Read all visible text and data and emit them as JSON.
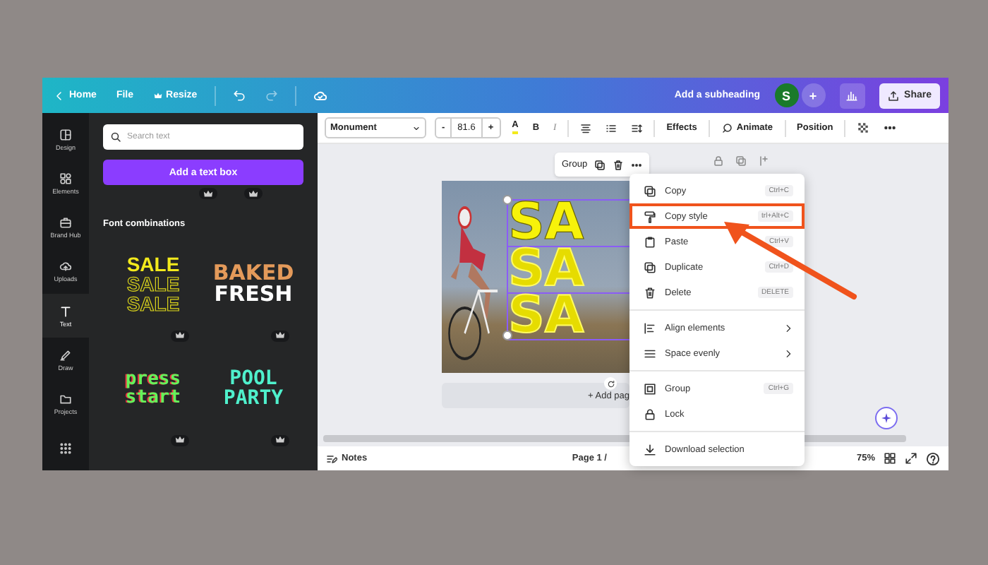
{
  "top_bar": {
    "home": "Home",
    "file": "File",
    "resize": "Resize",
    "title": "Add a subheading",
    "avatar": "S",
    "plus": "+",
    "share": "Share"
  },
  "rail": [
    {
      "label": "Design",
      "selected": false
    },
    {
      "label": "Elements",
      "selected": false
    },
    {
      "label": "Brand Hub",
      "selected": false
    },
    {
      "label": "Uploads",
      "selected": false
    },
    {
      "label": "Text",
      "selected": true
    },
    {
      "label": "Draw",
      "selected": false
    },
    {
      "label": "Projects",
      "selected": false
    },
    {
      "selected": false
    }
  ],
  "panel": {
    "search": {
      "placeholder": "Search text"
    },
    "add_button": "Add a text box",
    "section_title": "Font combinations",
    "combos": [
      {
        "kind": "sale",
        "lines": [
          "SALE",
          "SALE",
          "SALE"
        ]
      },
      {
        "kind": "baked",
        "lines": [
          "BAKED",
          "FRESH"
        ]
      },
      {
        "kind": "press",
        "lines": [
          "press",
          "start"
        ]
      },
      {
        "kind": "pool",
        "lines": [
          "POOL",
          "PARTY"
        ]
      }
    ]
  },
  "toolbar": {
    "font": "Monument",
    "decrease": "-",
    "font_size": "81.6",
    "increase": "+",
    "color_letter": "A",
    "bold": "B",
    "italic": "I",
    "effects": "Effects",
    "animate": "Animate",
    "position": "Position"
  },
  "canvas": {
    "selection_label": "Group",
    "text_layers": [
      "SA",
      "SA",
      "SA"
    ],
    "add_page": "+ Add pag"
  },
  "context_menu": [
    {
      "kind": "item",
      "label": "Copy",
      "shortcut": "Ctrl+C",
      "highlighted": false
    },
    {
      "kind": "item",
      "label": "Copy style",
      "shortcut": "trl+Alt+C",
      "highlighted": true
    },
    {
      "kind": "item",
      "label": "Paste",
      "shortcut": "Ctrl+V",
      "highlighted": false
    },
    {
      "kind": "item",
      "label": "Duplicate",
      "shortcut": "Ctrl+D",
      "highlighted": false
    },
    {
      "kind": "item",
      "label": "Delete",
      "shortcut": "DELETE",
      "highlighted": false
    },
    {
      "kind": "divider"
    },
    {
      "kind": "submenu",
      "label": "Align elements",
      "highlighted": false
    },
    {
      "kind": "submenu",
      "label": "Space evenly",
      "highlighted": false
    },
    {
      "kind": "divider"
    },
    {
      "kind": "item",
      "label": "Group",
      "shortcut": "Ctrl+G",
      "highlighted": false
    },
    {
      "kind": "item",
      "label": "Lock",
      "highlighted": false
    },
    {
      "kind": "divider"
    },
    {
      "kind": "item",
      "label": "Download selection",
      "highlighted": false
    }
  ],
  "bottom_bar": {
    "notes": "Notes",
    "page": "Page 1 /",
    "zoom": "75%"
  }
}
